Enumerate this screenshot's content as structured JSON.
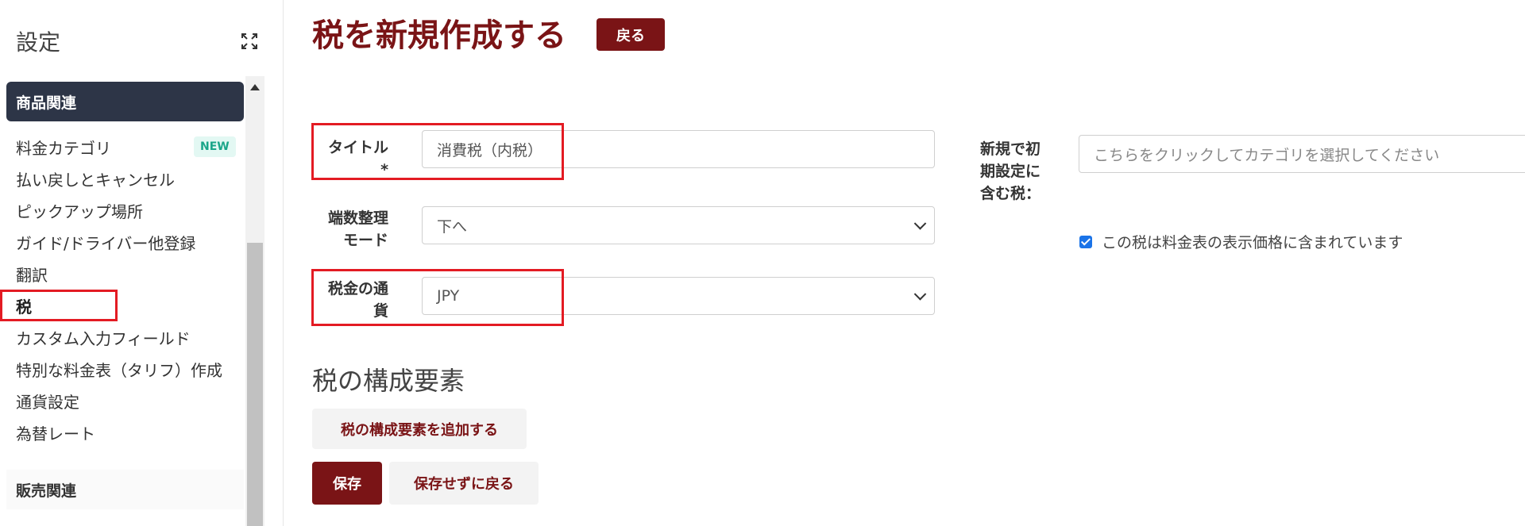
{
  "sidebar": {
    "title": "設定",
    "active_group": "商品関連",
    "items": [
      {
        "label": "料金カテゴリ",
        "badge": "NEW"
      },
      {
        "label": "払い戻しとキャンセル"
      },
      {
        "label": "ピックアップ場所"
      },
      {
        "label": "ガイド/ドライバー他登録"
      },
      {
        "label": "翻訳"
      },
      {
        "label": "税"
      },
      {
        "label": "カスタム入力フィールド"
      },
      {
        "label": "特別な料金表（タリフ）作成"
      },
      {
        "label": "通貨設定"
      },
      {
        "label": "為替レート"
      }
    ],
    "next_group": "販売関連"
  },
  "header": {
    "title": "税を新規作成する",
    "back_label": "戻る"
  },
  "form": {
    "title_label": "タイトル",
    "required_mark": "*",
    "title_value": "消費税（内税）",
    "rounding_label": "端数整理モード",
    "rounding_value": "下へ",
    "currency_label": "税金の通貨",
    "currency_value": "JPY",
    "default_tax_label": "新規で初期設定に含む税：",
    "default_tax_placeholder": "こちらをクリックしてカテゴリを選択してください",
    "included_checkbox_label": "この税は料金表の表示価格に含まれています",
    "included_checked": true
  },
  "components": {
    "section_title": "税の構成要素",
    "add_label": "税の構成要素を追加する"
  },
  "actions": {
    "save_label": "保存",
    "cancel_label": "保存せずに戻る"
  },
  "colors": {
    "brand": "#7a1416",
    "sidebar_active": "#2d3547",
    "highlight": "#e31b23"
  }
}
